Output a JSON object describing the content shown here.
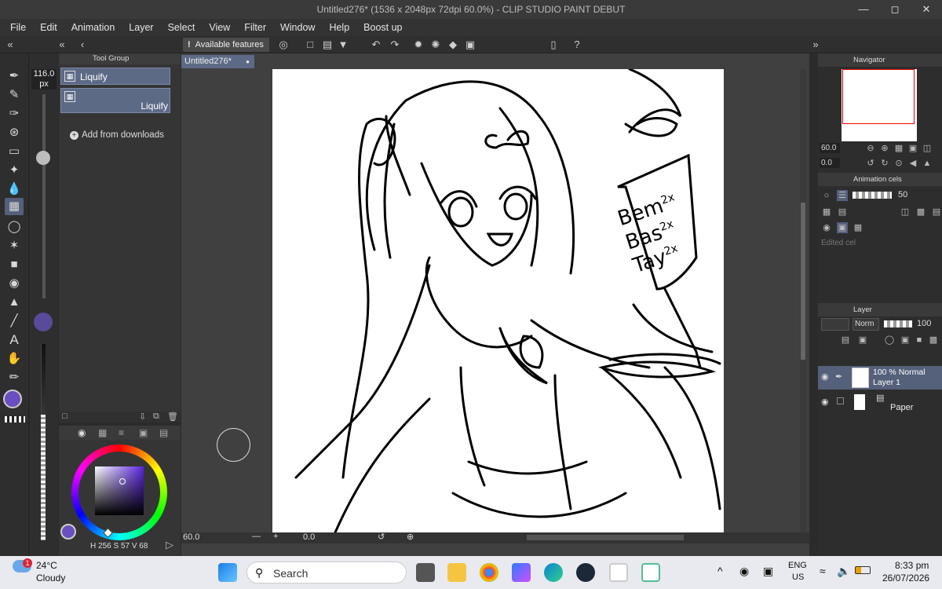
{
  "window": {
    "title": "Untitled276* (1536 x 2048px 72dpi 60.0%) - CLIP STUDIO PAINT DEBUT"
  },
  "menu": [
    "File",
    "Edit",
    "Animation",
    "Layer",
    "Select",
    "View",
    "Filter",
    "Window",
    "Help",
    "Boost up"
  ],
  "commandbar": {
    "available_features": "Available features"
  },
  "brush_size": {
    "value": "116.0",
    "unit": "px"
  },
  "subtool": {
    "panel_title": "Tool Group",
    "items": [
      "Liquify",
      "Liquify"
    ],
    "add_downloads": "Add from downloads"
  },
  "color": {
    "main": "#6a4fc0",
    "values": {
      "h_label": "H",
      "h": "256",
      "s_label": "S",
      "s": "57",
      "v_label": "V",
      "v": "68"
    }
  },
  "document": {
    "tab": "Untitled276*"
  },
  "statusbar": {
    "zoom": "60.0",
    "rotation": "0.0"
  },
  "canvas_text": {
    "line1": "Bem",
    "line2": "Bas",
    "line3": "Tay",
    "sup": "2x"
  },
  "navigator": {
    "title": "Navigator",
    "zoom": "60.0",
    "angle": "0.0"
  },
  "animation_cels": {
    "title": "Animation cels",
    "opacity": "50",
    "edited_cel": "Edited cel"
  },
  "layer": {
    "title": "Layer",
    "blend": "Norm",
    "opacity": "100",
    "layers": [
      {
        "info": "100 % Normal",
        "name": "Layer 1"
      },
      {
        "info": "",
        "name": "Paper"
      }
    ]
  },
  "taskbar": {
    "weather_temp": "24°C",
    "weather_desc": "Cloudy",
    "weather_badge": "1",
    "search": "Search",
    "lang": "ENG",
    "region": "US",
    "time": "8:33 pm",
    "date": "26/07/2026"
  }
}
